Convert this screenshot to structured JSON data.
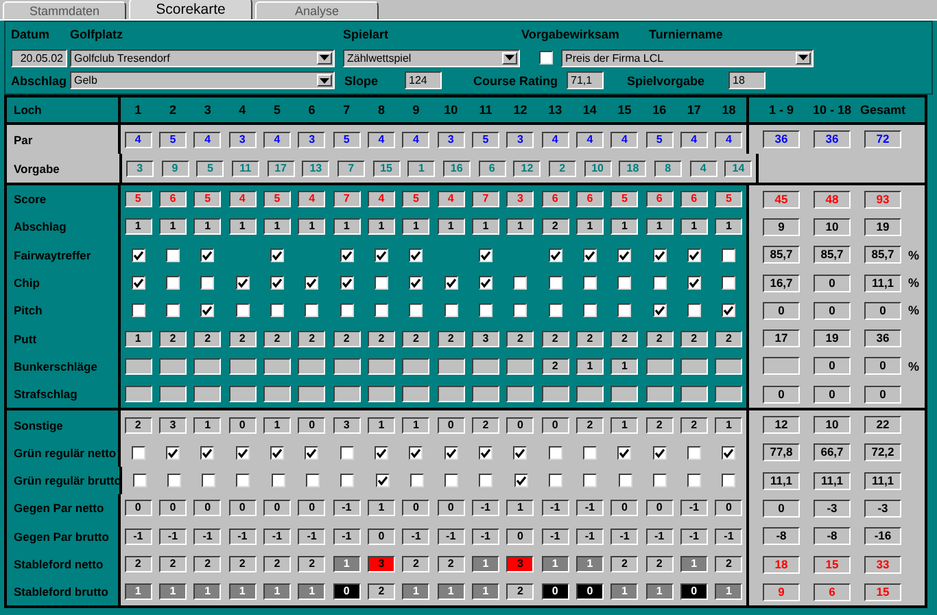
{
  "tabs": [
    {
      "label": "Stammdaten",
      "selected": false
    },
    {
      "label": "Scorekarte",
      "selected": true
    },
    {
      "label": "Analyse",
      "selected": false
    }
  ],
  "header": {
    "date": {
      "label": "Datum",
      "value": "20.05.02"
    },
    "course": {
      "label": "Golfplatz",
      "value": "Golfclub Tresendorf"
    },
    "game_type": {
      "label": "Spielart",
      "value": "Zählwettspiel"
    },
    "handicap_relevant": {
      "label": "Vorgabewirksam",
      "checked": false
    },
    "tournament": {
      "label": "Turniername",
      "value": "Preis der Firma LCL"
    },
    "tee": {
      "label": "Abschlag",
      "value": "Gelb"
    },
    "slope": {
      "label": "Slope",
      "value": "124"
    },
    "course_rating": {
      "label": "Course Rating",
      "value": "71,1"
    },
    "playing_handicap": {
      "label": "Spielvorgabe",
      "value": "18"
    }
  },
  "scorecard": {
    "corner": "Loch",
    "holes": [
      "1",
      "2",
      "3",
      "4",
      "5",
      "6",
      "7",
      "8",
      "9",
      "10",
      "11",
      "12",
      "13",
      "14",
      "15",
      "16",
      "17",
      "18"
    ],
    "total_headers": [
      "1 - 9",
      "10 - 18",
      "Gesamt"
    ],
    "sections": [
      {
        "kind": "grey",
        "rows": [
          {
            "label": "Par",
            "kind": "numbers",
            "color": "#0000ff",
            "cells": [
              "4",
              "5",
              "4",
              "3",
              "4",
              "3",
              "5",
              "4",
              "4",
              "3",
              "5",
              "3",
              "4",
              "4",
              "4",
              "5",
              "4",
              "4"
            ],
            "totals": {
              "color": "#0000ff",
              "first_nine": "36",
              "second_nine": "36",
              "total": "72"
            }
          },
          {
            "label": "Vorgabe",
            "kind": "numbers",
            "color": "#007f7f",
            "cells": [
              "3",
              "9",
              "5",
              "11",
              "17",
              "13",
              "7",
              "15",
              "1",
              "16",
              "6",
              "12",
              "2",
              "10",
              "18",
              "8",
              "4",
              "14"
            ]
          }
        ]
      },
      {
        "kind": "teal",
        "rows": [
          {
            "label": "Score",
            "kind": "numbers",
            "color": "#ff0000",
            "cells": [
              "5",
              "6",
              "5",
              "4",
              "5",
              "4",
              "7",
              "4",
              "5",
              "4",
              "7",
              "3",
              "6",
              "6",
              "5",
              "6",
              "6",
              "5"
            ],
            "totals": {
              "color": "#ff0000",
              "first_nine": "45",
              "second_nine": "48",
              "total": "93"
            }
          },
          {
            "label": "Abschlag",
            "kind": "numbers",
            "color": "#000000",
            "cells": [
              "1",
              "1",
              "1",
              "1",
              "1",
              "1",
              "1",
              "1",
              "1",
              "1",
              "1",
              "1",
              "2",
              "1",
              "1",
              "1",
              "1",
              "1"
            ],
            "totals": {
              "color": "#000000",
              "first_nine": "9",
              "second_nine": "10",
              "total": "19"
            }
          },
          {
            "label": "Fairwaytreffer",
            "kind": "checks",
            "cells": [
              {
                "kind": "check",
                "checked": true
              },
              {
                "kind": "check",
                "checked": false
              },
              {
                "kind": "check",
                "checked": true
              },
              {
                "kind": "none"
              },
              {
                "kind": "check",
                "checked": true
              },
              {
                "kind": "none"
              },
              {
                "kind": "check",
                "checked": true
              },
              {
                "kind": "check",
                "checked": true
              },
              {
                "kind": "check",
                "checked": true
              },
              {
                "kind": "none"
              },
              {
                "kind": "check",
                "checked": true
              },
              {
                "kind": "none"
              },
              {
                "kind": "check",
                "checked": true
              },
              {
                "kind": "check",
                "checked": true
              },
              {
                "kind": "check",
                "checked": true
              },
              {
                "kind": "check",
                "checked": true
              },
              {
                "kind": "check",
                "checked": true
              },
              {
                "kind": "check",
                "checked": false
              }
            ],
            "totals": {
              "color": "#000000",
              "first_nine": "85,7",
              "second_nine": "85,7",
              "total": "85,7",
              "unit": "%"
            }
          },
          {
            "label": "Chip",
            "kind": "checks",
            "cells": [
              {
                "kind": "check",
                "checked": true
              },
              {
                "kind": "check",
                "checked": false
              },
              {
                "kind": "check",
                "checked": false
              },
              {
                "kind": "check",
                "checked": true
              },
              {
                "kind": "check",
                "checked": true
              },
              {
                "kind": "check",
                "checked": true
              },
              {
                "kind": "check",
                "checked": true
              },
              {
                "kind": "check",
                "checked": false
              },
              {
                "kind": "check",
                "checked": true
              },
              {
                "kind": "check",
                "checked": true
              },
              {
                "kind": "check",
                "checked": true
              },
              {
                "kind": "check",
                "checked": false
              },
              {
                "kind": "check",
                "checked": false
              },
              {
                "kind": "check",
                "checked": false
              },
              {
                "kind": "check",
                "checked": false
              },
              {
                "kind": "check",
                "checked": false
              },
              {
                "kind": "check",
                "checked": true
              },
              {
                "kind": "check",
                "checked": false
              }
            ],
            "totals": {
              "color": "#000000",
              "first_nine": "16,7",
              "second_nine": "0",
              "total": "11,1",
              "unit": "%"
            }
          },
          {
            "label": "Pitch",
            "kind": "checks",
            "cells": [
              {
                "kind": "check",
                "checked": false
              },
              {
                "kind": "check",
                "checked": false
              },
              {
                "kind": "check",
                "checked": true
              },
              {
                "kind": "check",
                "checked": false
              },
              {
                "kind": "check",
                "checked": false
              },
              {
                "kind": "check",
                "checked": false
              },
              {
                "kind": "check",
                "checked": false
              },
              {
                "kind": "check",
                "checked": false
              },
              {
                "kind": "check",
                "checked": false
              },
              {
                "kind": "check",
                "checked": false
              },
              {
                "kind": "check",
                "checked": false
              },
              {
                "kind": "check",
                "checked": false
              },
              {
                "kind": "check",
                "checked": false
              },
              {
                "kind": "check",
                "checked": false
              },
              {
                "kind": "check",
                "checked": false
              },
              {
                "kind": "check",
                "checked": true
              },
              {
                "kind": "check",
                "checked": false
              },
              {
                "kind": "check",
                "checked": true
              }
            ],
            "totals": {
              "color": "#000000",
              "first_nine": "0",
              "second_nine": "0",
              "total": "0",
              "unit": "%"
            }
          },
          {
            "label": "Putt",
            "kind": "numbers",
            "color": "#000000",
            "cells": [
              "1",
              "2",
              "2",
              "2",
              "2",
              "2",
              "2",
              "2",
              "2",
              "2",
              "3",
              "2",
              "2",
              "2",
              "2",
              "2",
              "2",
              "2"
            ],
            "totals": {
              "color": "#000000",
              "first_nine": "17",
              "second_nine": "19",
              "total": "36"
            }
          },
          {
            "label": "Bunkerschläge",
            "kind": "numbers",
            "color": "#000000",
            "cells": [
              null,
              null,
              null,
              null,
              null,
              null,
              null,
              null,
              null,
              null,
              null,
              null,
              "2",
              "1",
              "1",
              null,
              null,
              null
            ],
            "totals": {
              "color": "#000000",
              "second_nine": "0",
              "total": "0",
              "unit": "%"
            }
          },
          {
            "label": "Strafschlag",
            "kind": "numbers",
            "cells": [
              null,
              null,
              null,
              null,
              null,
              null,
              null,
              null,
              null,
              null,
              null,
              null,
              null,
              null,
              null,
              null,
              null,
              null
            ],
            "totals": {
              "color": "#000000",
              "first_nine": "0",
              "second_nine": "0",
              "total": "0"
            }
          }
        ]
      },
      {
        "kind": "split",
        "rows": [
          {
            "label": "Sonstige",
            "kind": "numbers",
            "color": "#000000",
            "cells": [
              "2",
              "3",
              "1",
              "0",
              "1",
              "0",
              "3",
              "1",
              "1",
              "0",
              "2",
              "0",
              "0",
              "2",
              "1",
              "2",
              "2",
              "1"
            ],
            "totals": {
              "color": "#000000",
              "first_nine": "12",
              "second_nine": "10",
              "total": "22"
            }
          },
          {
            "label": "Grün regulär netto",
            "kind": "checks",
            "cells": [
              {
                "kind": "check",
                "checked": false
              },
              {
                "kind": "check",
                "checked": true
              },
              {
                "kind": "check",
                "checked": true
              },
              {
                "kind": "check",
                "checked": true
              },
              {
                "kind": "check",
                "checked": true
              },
              {
                "kind": "check",
                "checked": true
              },
              {
                "kind": "check",
                "checked": false
              },
              {
                "kind": "check",
                "checked": true
              },
              {
                "kind": "check",
                "checked": true
              },
              {
                "kind": "check",
                "checked": true
              },
              {
                "kind": "check",
                "checked": true
              },
              {
                "kind": "check",
                "checked": true
              },
              {
                "kind": "check",
                "checked": false
              },
              {
                "kind": "check",
                "checked": false
              },
              {
                "kind": "check",
                "checked": true
              },
              {
                "kind": "check",
                "checked": true
              },
              {
                "kind": "check",
                "checked": false
              },
              {
                "kind": "check",
                "checked": true
              }
            ],
            "totals": {
              "color": "#000000",
              "first_nine": "77,8",
              "second_nine": "66,7",
              "total": "72,2"
            }
          },
          {
            "label": "Grün regulär brutto",
            "kind": "checks",
            "cells": [
              {
                "kind": "check",
                "checked": false
              },
              {
                "kind": "check",
                "checked": false
              },
              {
                "kind": "check",
                "checked": false
              },
              {
                "kind": "check",
                "checked": false
              },
              {
                "kind": "check",
                "checked": false
              },
              {
                "kind": "check",
                "checked": false
              },
              {
                "kind": "check",
                "checked": false
              },
              {
                "kind": "check",
                "checked": true
              },
              {
                "kind": "check",
                "checked": false
              },
              {
                "kind": "check",
                "checked": false
              },
              {
                "kind": "check",
                "checked": false
              },
              {
                "kind": "check",
                "checked": true
              },
              {
                "kind": "check",
                "checked": false
              },
              {
                "kind": "check",
                "checked": false
              },
              {
                "kind": "check",
                "checked": false
              },
              {
                "kind": "check",
                "checked": false
              },
              {
                "kind": "check",
                "checked": false
              },
              {
                "kind": "check",
                "checked": false
              }
            ],
            "totals": {
              "color": "#000000",
              "first_nine": "11,1",
              "second_nine": "11,1",
              "total": "11,1"
            }
          },
          {
            "label": "Gegen Par netto",
            "kind": "numbers",
            "color": "#000000",
            "cells": [
              "0",
              "0",
              "0",
              "0",
              "0",
              "0",
              "-1",
              "1",
              "0",
              "0",
              "-1",
              "1",
              "-1",
              "-1",
              "0",
              "0",
              "-1",
              "0"
            ],
            "totals": {
              "color": "#000000",
              "first_nine": "0",
              "second_nine": "-3",
              "total": "-3"
            }
          },
          {
            "label": "Gegen Par brutto",
            "kind": "numbers",
            "color": "#000000",
            "cells": [
              "-1",
              "-1",
              "-1",
              "-1",
              "-1",
              "-1",
              "-1",
              "0",
              "-1",
              "-1",
              "-1",
              "0",
              "-1",
              "-1",
              "-1",
              "-1",
              "-1",
              "-1"
            ],
            "totals": {
              "color": "#000000",
              "first_nine": "-8",
              "second_nine": "-8",
              "total": "-16"
            }
          },
          {
            "label": "Stableford netto",
            "kind": "shaded",
            "cells": [
              {
                "value": "2",
                "kind": "plain"
              },
              {
                "value": "2",
                "kind": "plain"
              },
              {
                "value": "2",
                "kind": "plain"
              },
              {
                "value": "2",
                "kind": "plain"
              },
              {
                "value": "2",
                "kind": "plain"
              },
              {
                "value": "2",
                "kind": "plain"
              },
              {
                "value": "1",
                "kind": "dark"
              },
              {
                "value": "3",
                "kind": "red"
              },
              {
                "value": "2",
                "kind": "plain"
              },
              {
                "value": "2",
                "kind": "plain"
              },
              {
                "value": "1",
                "kind": "dark"
              },
              {
                "value": "3",
                "kind": "red"
              },
              {
                "value": "1",
                "kind": "dark"
              },
              {
                "value": "1",
                "kind": "dark"
              },
              {
                "value": "2",
                "kind": "plain"
              },
              {
                "value": "2",
                "kind": "plain"
              },
              {
                "value": "1",
                "kind": "dark"
              },
              {
                "value": "2",
                "kind": "plain"
              }
            ],
            "totals": {
              "color": "#ff0000",
              "first_nine": "18",
              "second_nine": "15",
              "total": "33"
            }
          },
          {
            "label": "Stableford brutto",
            "kind": "shaded",
            "cells": [
              {
                "value": "1",
                "kind": "dark"
              },
              {
                "value": "1",
                "kind": "dark"
              },
              {
                "value": "1",
                "kind": "dark"
              },
              {
                "value": "1",
                "kind": "dark"
              },
              {
                "value": "1",
                "kind": "dark"
              },
              {
                "value": "1",
                "kind": "dark"
              },
              {
                "value": "0",
                "kind": "black"
              },
              {
                "value": "2",
                "kind": "plain"
              },
              {
                "value": "1",
                "kind": "dark"
              },
              {
                "value": "1",
                "kind": "dark"
              },
              {
                "value": "1",
                "kind": "dark"
              },
              {
                "value": "2",
                "kind": "plain"
              },
              {
                "value": "0",
                "kind": "black"
              },
              {
                "value": "0",
                "kind": "black"
              },
              {
                "value": "1",
                "kind": "dark"
              },
              {
                "value": "1",
                "kind": "dark"
              },
              {
                "value": "0",
                "kind": "black"
              },
              {
                "value": "1",
                "kind": "dark"
              }
            ],
            "totals": {
              "color": "#ff0000",
              "first_nine": "9",
              "second_nine": "6",
              "total": "15"
            }
          }
        ]
      }
    ]
  }
}
